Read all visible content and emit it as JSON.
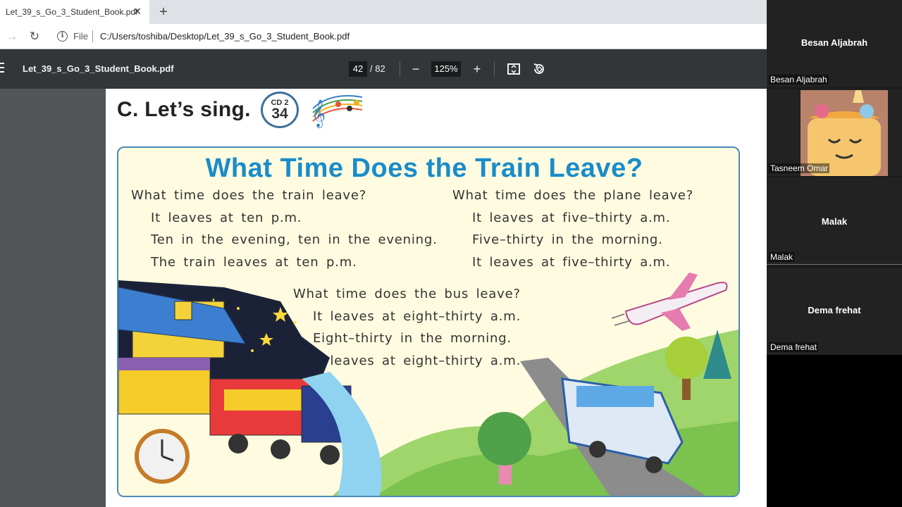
{
  "browser": {
    "tab_title": "Let_39_s_Go_3_Student_Book.pdf",
    "tab_close": "✕",
    "new_tab": "+",
    "file_label": "File",
    "url": "C:/Users/toshiba/Desktop/Let_39_s_Go_3_Student_Book.pdf"
  },
  "pdf_toolbar": {
    "title": "Let_39_s_Go_3_Student_Book.pdf",
    "current_page": "42",
    "total_pages": "/ 82",
    "zoom": "125%"
  },
  "page": {
    "heading": "C. Let’s sing.",
    "cd_label": "CD 2",
    "cd_number": "34",
    "song_title": "What Time Does the Train Leave?",
    "verse1": [
      "What time does the train leave?",
      "It leaves at ten p.m.",
      "Ten in the evening, ten in the evening.",
      "The train leaves at ten p.m."
    ],
    "verse2": [
      "What time does the plane leave?",
      "It leaves at five–thirty a.m.",
      "Five–thirty in the morning.",
      "It leaves at five–thirty a.m."
    ],
    "verse3": [
      "What time does the bus leave?",
      "It leaves at eight–thirty a.m.",
      "Eight–thirty in the morning.",
      "It leaves at eight–thirty a.m."
    ]
  },
  "participants": [
    {
      "name_center": "Besan Aljabrah",
      "name_corner": "Besan Aljabrah"
    },
    {
      "name_center": "",
      "name_corner": "Tasneem Omar"
    },
    {
      "name_center": "Malak",
      "name_corner": "Malak"
    },
    {
      "name_center": "Dema frehat",
      "name_corner": "Dema frehat"
    }
  ],
  "colors": {
    "song_title": "#1a8cc9",
    "panel_border": "#4a8bb8",
    "pdf_toolbar_bg": "#323639",
    "viewer_bg": "#525659"
  }
}
